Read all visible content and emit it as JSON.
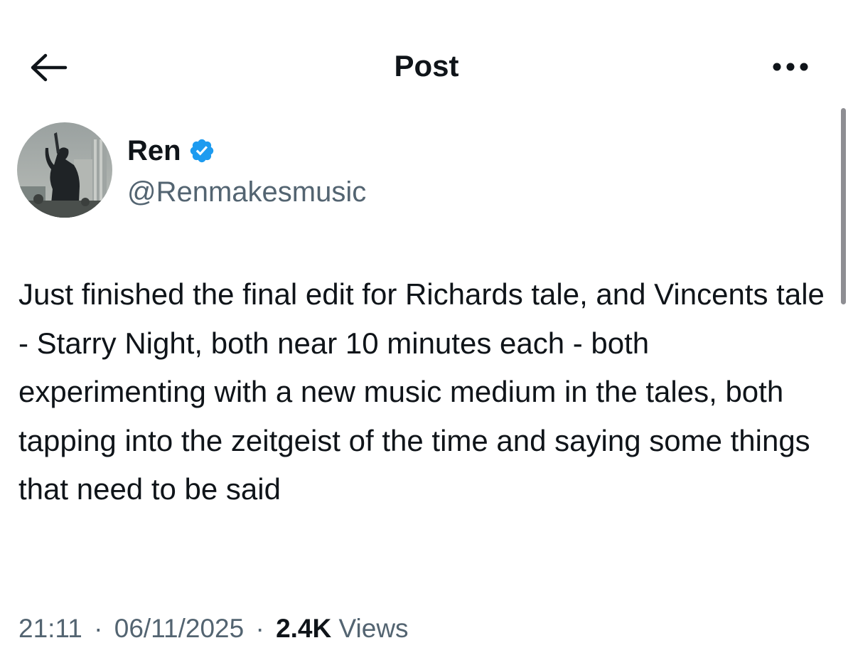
{
  "header": {
    "title": "Post",
    "back_icon": "arrow-left-icon",
    "more_icon": "more-horizontal-icon"
  },
  "author": {
    "display_name": "Ren",
    "handle": "@Renmakesmusic",
    "verified": true,
    "verified_color": "#1d9bf0",
    "avatar_icon": "avatar-photo"
  },
  "post": {
    "text": "Just finished the final edit for Richards tale, and Vincents tale - Starry Night, both near 10 minutes each - both experimenting with a new music medium in the tales, both tapping into the zeitgeist of the time and saying some things that need to be said"
  },
  "meta": {
    "time": "21:11",
    "separator": "·",
    "date": "06/11/2025",
    "views_count": "2.4K",
    "views_label": "Views"
  },
  "colors": {
    "text_primary": "#0f1419",
    "text_secondary": "#536471",
    "background": "#ffffff",
    "accent": "#1d9bf0"
  }
}
